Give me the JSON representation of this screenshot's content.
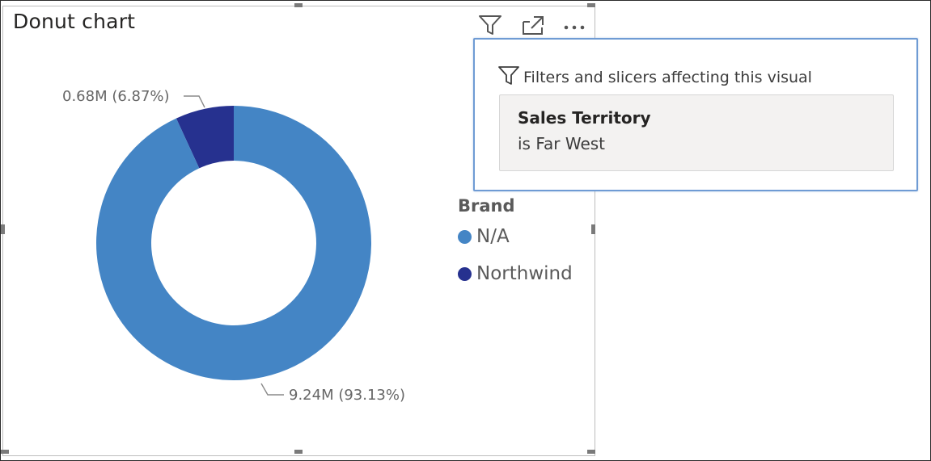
{
  "visual": {
    "title": "Donut chart",
    "header_icons": [
      "filter-icon",
      "focus-mode-icon",
      "more-options-icon"
    ]
  },
  "chart_data": {
    "type": "pie",
    "variant": "donut",
    "title": "Donut chart",
    "slices": [
      {
        "category": "N/A",
        "value": 9.24,
        "percent": 93.13,
        "label": "9.24M (93.13%)",
        "color": "#4485c5"
      },
      {
        "category": "Northwind",
        "value": 0.68,
        "percent": 6.87,
        "label": "0.68M (6.87%)",
        "color": "#26318f"
      }
    ],
    "legend": {
      "title": "Brand",
      "placement": "right",
      "items": [
        "N/A",
        "Northwind"
      ]
    }
  },
  "flyout": {
    "heading": "Filters and slicers affecting this visual",
    "filter": {
      "field": "Sales Territory",
      "condition": "is Far West"
    }
  },
  "colors": {
    "accent_border": "#6f9bd4",
    "series_na": "#4485c5",
    "series_northwind": "#26318f"
  }
}
